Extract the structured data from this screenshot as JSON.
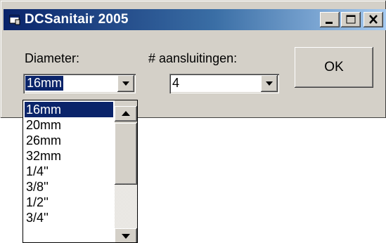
{
  "window": {
    "title": "DCSanitair 2005",
    "icon": "app-window-icon",
    "controls": [
      "minimize-icon",
      "maximize-icon",
      "close-icon"
    ]
  },
  "form": {
    "diameter_label": "Diameter:",
    "diameter_value": "16mm",
    "aansluitingen_label": "# aansluitingen:",
    "aansluitingen_value": "4",
    "ok_label": "OK"
  },
  "dropdown": {
    "items": [
      "16mm",
      "20mm",
      "26mm",
      "32mm",
      "1/4''",
      "3/8''",
      "1/2''",
      "3/4''"
    ],
    "selected": "16mm"
  },
  "colors": {
    "title_start": "#0a246a",
    "title_end": "#a6caf0",
    "face": "#d4d0c8",
    "selection": "#0a246a"
  }
}
